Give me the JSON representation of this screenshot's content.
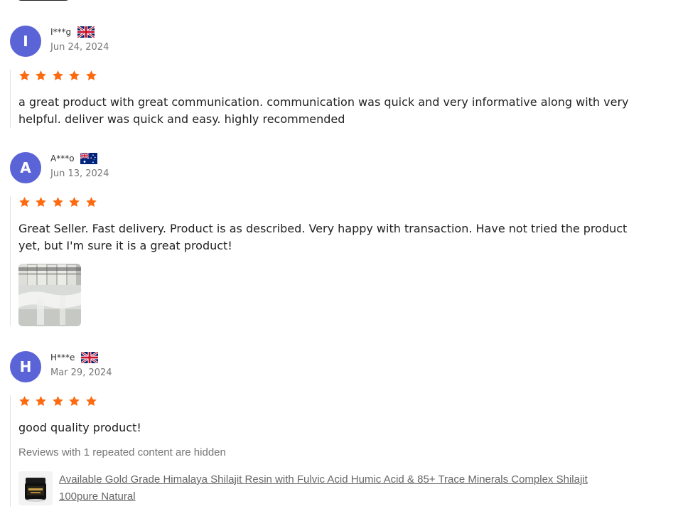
{
  "colors": {
    "avatar_bg": "#5b64d7",
    "star": "#fd6a10",
    "divider": "#e4e4e4",
    "muted_text": "#767676"
  },
  "reviews": [
    {
      "avatar_letter": "I",
      "name": "I***g",
      "flag": "uk-flag-icon",
      "date": "Jun 24, 2024",
      "rating": 5,
      "text": "a great product with great communication. communication was quick and very informative along with very helpful. deliver was quick and easy. highly recommended"
    },
    {
      "avatar_letter": "A",
      "name": "A***o",
      "flag": "australia-flag-icon",
      "date": "Jun 13, 2024",
      "rating": 5,
      "text": "Great Seller. Fast delivery. Product is as described. Very happy with transaction. Have not tried the product yet, but I'm sure it is a great product!",
      "photo_icon": "review-photo-thumbnail"
    },
    {
      "avatar_letter": "H",
      "name": "H***e",
      "flag": "uk-flag-icon",
      "date": "Mar 29, 2024",
      "rating": 5,
      "text": "good quality product!"
    }
  ],
  "hidden_note": "Reviews with 1 repeated content are hidden",
  "product": {
    "thumb_icon": "product-jar-icon",
    "link_text": "Available Gold Grade Himalaya Shilajit Resin with Fulvic Acid Humic Acid & 85+ Trace Minerals Complex Shilajit 100pure Natural"
  }
}
